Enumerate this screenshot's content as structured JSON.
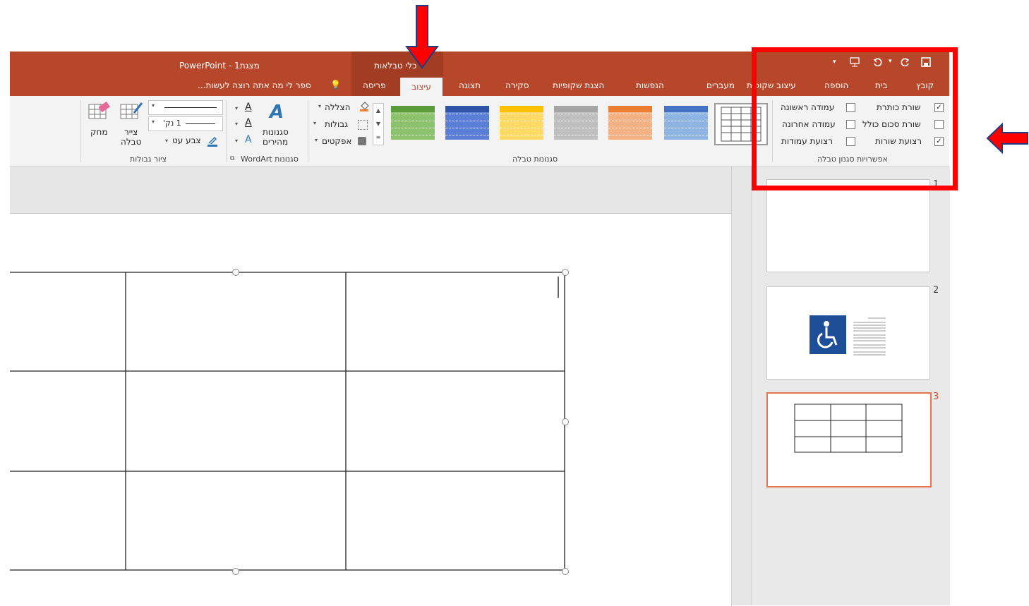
{
  "window": {
    "title": "מצגת1 - PowerPoint",
    "contextual_group": "כלי טבלאות"
  },
  "quick_access": {
    "icons": [
      "save-icon",
      "redo-icon",
      "undo-icon",
      "start-from-beginning-icon",
      "customize-icon"
    ]
  },
  "tabs": [
    "קובץ",
    "בית",
    "הוספה",
    "עיצוב שקופית",
    "מעברים",
    "הנפשות",
    "הצגת שקופיות",
    "סקירה",
    "תצוגה",
    "עיצוב",
    "פריסה"
  ],
  "active_tab": "עיצוב",
  "tell_me": "ספר לי מה אתה רוצה לעשות...",
  "table_style_options": {
    "group_label": "אפשרויות סגנון טבלה",
    "header_row": {
      "label": "שורת כותרת",
      "checked": true
    },
    "first_column": {
      "label": "עמודה ראשונה",
      "checked": false
    },
    "total_row": {
      "label": "שורת סכום כולל",
      "checked": false
    },
    "last_column": {
      "label": "עמודה אחרונה",
      "checked": false
    },
    "banded_rows": {
      "label": "רצועת שורות",
      "checked": true
    },
    "banded_columns": {
      "label": "רצועת עמודות",
      "checked": false
    }
  },
  "table_styles": {
    "group_label": "סגנונות טבלה",
    "swatch_colors": [
      "#4472c4",
      "#ed7d31",
      "#a5a5a5",
      "#ffc000",
      "#4472c4",
      "#70ad47"
    ],
    "shading": "הצללה",
    "borders": "גבולות",
    "effects": "אפקטים"
  },
  "wordart": {
    "group_label": "סגנונות WordArt",
    "quick_styles_line1": "סגנונות",
    "quick_styles_line2": "מהירים"
  },
  "draw_borders": {
    "group_label": "ציור גבולות",
    "pen_weight": "1 נק'",
    "pen_color": "צבע עט",
    "draw_table_line1": "צייר",
    "draw_table_line2": "טבלה",
    "eraser": "מחק"
  },
  "slides": [
    {
      "number": "1"
    },
    {
      "number": "2"
    },
    {
      "number": "3"
    }
  ],
  "colors": {
    "accent": "#b7472a",
    "annotation_red": "#ff0000"
  }
}
